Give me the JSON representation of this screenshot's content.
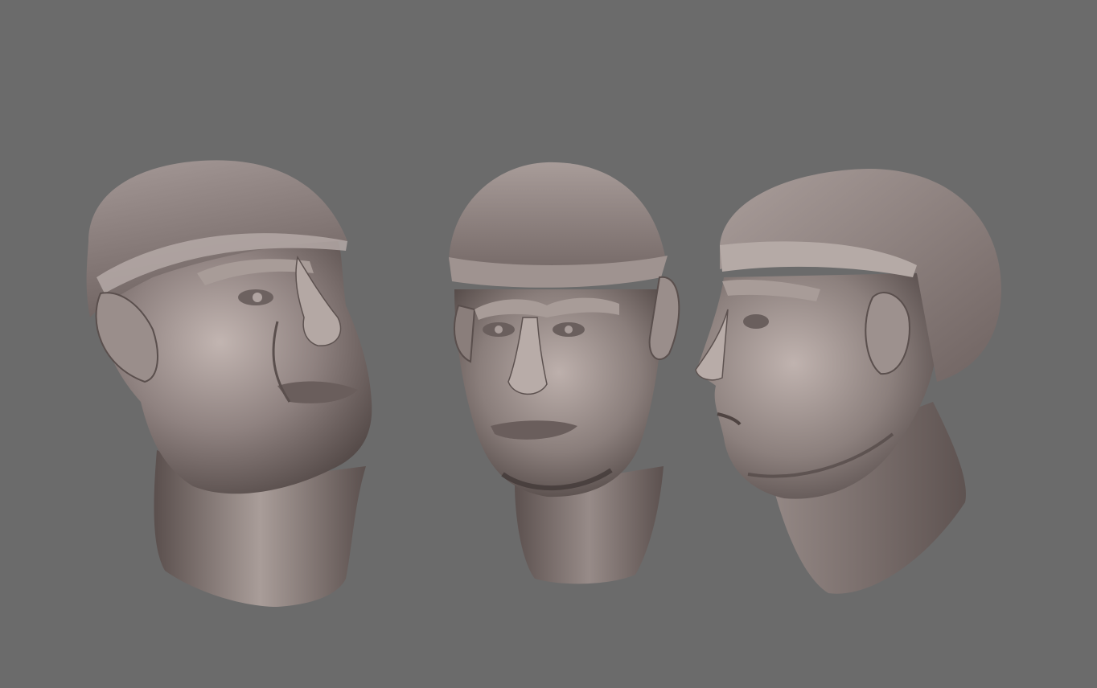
{
  "viewport": {
    "background": "#6b6b6b"
  },
  "material": {
    "base": "#8c7e7b",
    "light": "#b7aaa6",
    "highlight": "#d6cbc7",
    "shadow": "#4a403e",
    "deep_shadow": "#2f2827"
  },
  "models": [
    {
      "name": "head-three-quarter-view",
      "view": "three-quarter"
    },
    {
      "name": "head-front-view",
      "view": "front"
    },
    {
      "name": "head-profile-view",
      "view": "profile"
    }
  ]
}
